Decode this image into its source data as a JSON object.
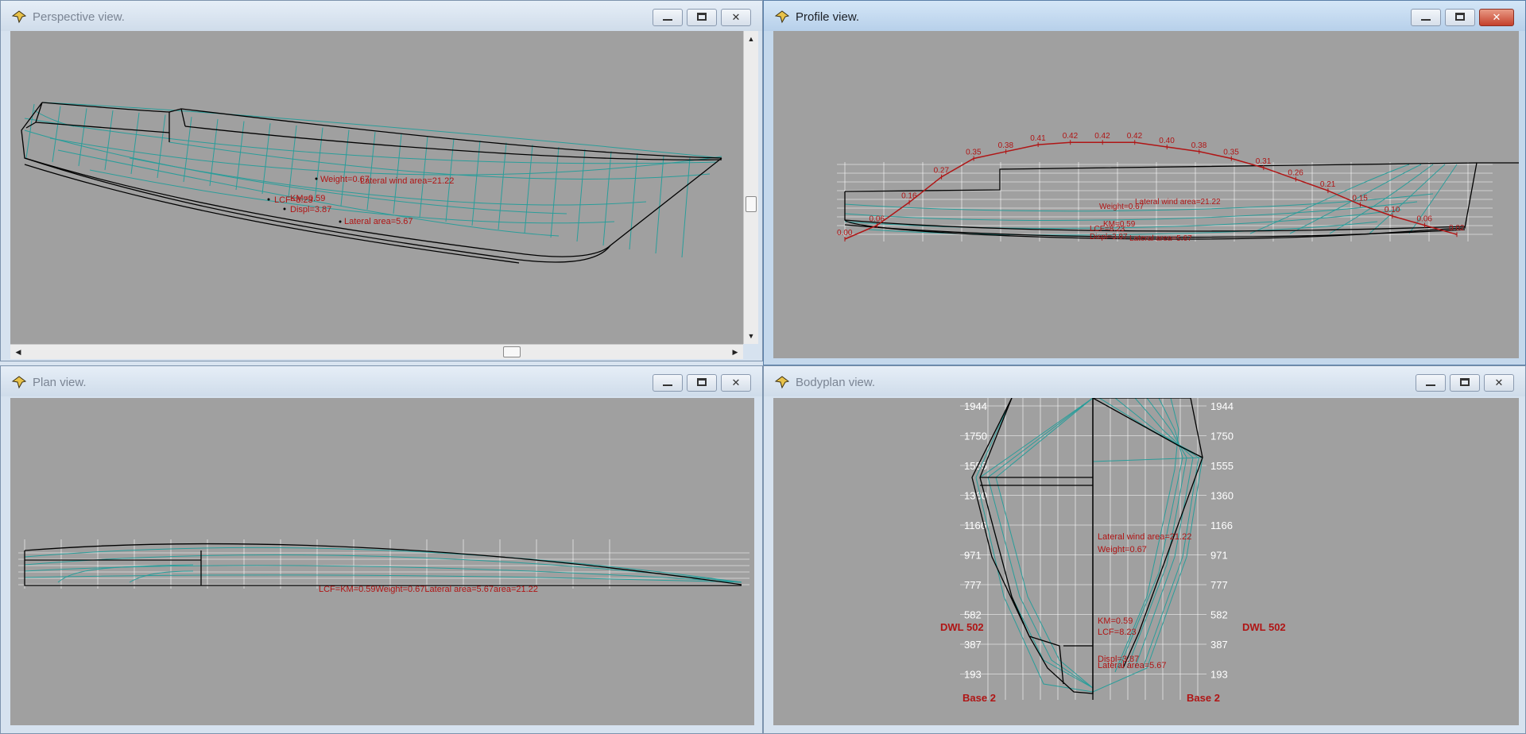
{
  "windows": {
    "perspective": {
      "title": "Perspective view."
    },
    "profile": {
      "title": "Profile view."
    },
    "plan": {
      "title": "Plan view."
    },
    "bodyplan": {
      "title": "Bodyplan view."
    }
  },
  "hydro": {
    "weight": "Weight=0.67",
    "lateral_wind": "Lateral wind area=21.22",
    "lcf": "LCF=8.23",
    "km": "KM=0.59",
    "displ": "Displ=3.87",
    "lateral_area": "Lateral area=5.67"
  },
  "profile_curve": {
    "values": [
      "0.00",
      "0.06",
      "0.16",
      "0.27",
      "0.35",
      "0.38",
      "0.41",
      "0.42",
      "0.42",
      "0.42",
      "0.40",
      "0.38",
      "0.35",
      "0.31",
      "0.26",
      "0.21",
      "0.15",
      "0.10",
      "0.06",
      "0.02"
    ]
  },
  "plan_overlap_label": "LCF=KM=0.59Weight=0.67Lateral area=5.67area=21.22",
  "bodyplan": {
    "waterlines": [
      "1944",
      "1750",
      "1555",
      "1360",
      "1166",
      "971",
      "777",
      "582",
      "387",
      "193"
    ],
    "dwl": "DWL 502",
    "base": "Base 2"
  },
  "colors": {
    "canvas_bg": "#a0a0a0",
    "hull_line": "#000000",
    "station_line": "#2a9d9a",
    "annotation": "#b01515"
  },
  "icons": {
    "title": "pin-icon",
    "minimize": "minimize-icon",
    "maximize": "maximize-icon",
    "close": "close-icon"
  }
}
